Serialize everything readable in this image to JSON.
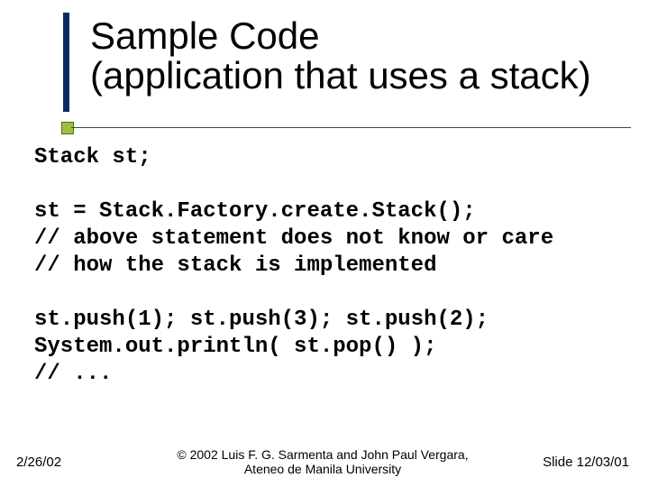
{
  "title": {
    "line1": "Sample Code",
    "line2": "(application that uses a stack)"
  },
  "code": {
    "l1": "Stack st;",
    "l2": "",
    "l3": "st = Stack.Factory.create.Stack();",
    "l4": "// above statement does not know or care",
    "l5": "// how the stack is implemented",
    "l6": "",
    "l7": "st.push(1); st.push(3); st.push(2);",
    "l8": "System.out.println( st.pop() );",
    "l9": "// ..."
  },
  "footer": {
    "date": "2/26/02",
    "copyright_line1": "© 2002 Luis F. G. Sarmenta and John Paul Vergara,",
    "copyright_line2": "Ateneo de Manila University",
    "slide": "Slide 12/03/01"
  }
}
